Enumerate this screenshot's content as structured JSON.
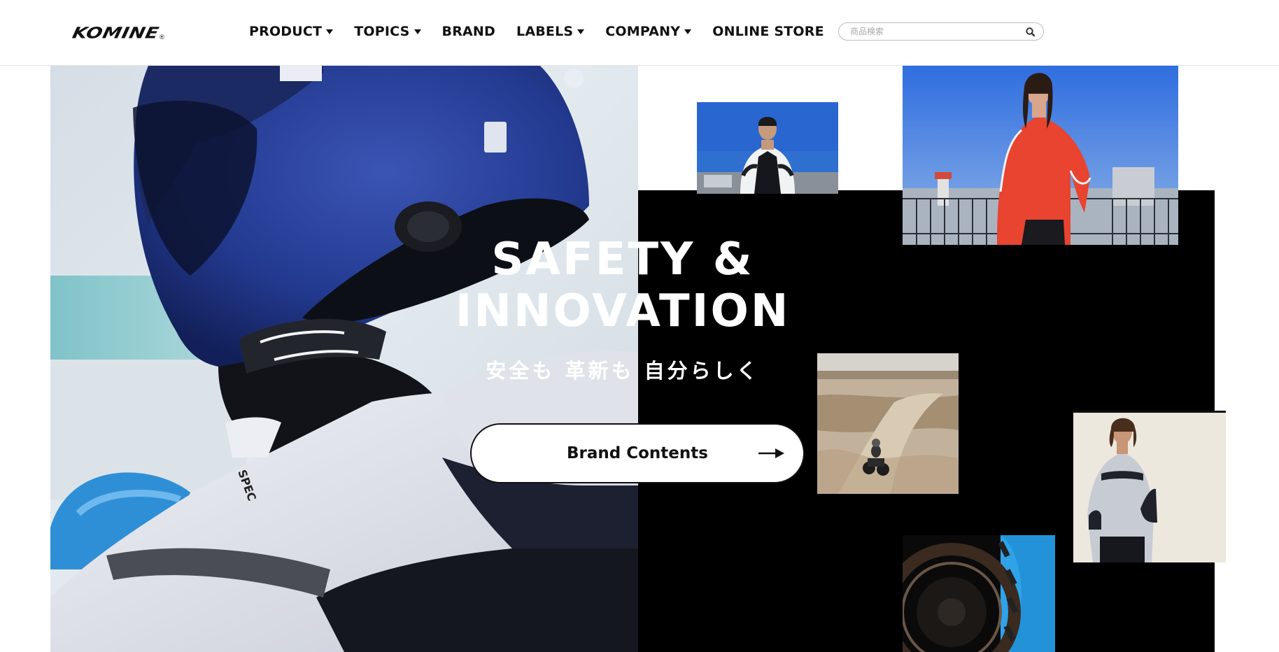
{
  "header": {
    "logo": "KOMINE",
    "logo_mark": "®",
    "nav": [
      {
        "label": "PRODUCT",
        "has_dropdown": true
      },
      {
        "label": "TOPICS",
        "has_dropdown": true
      },
      {
        "label": "BRAND",
        "has_dropdown": false
      },
      {
        "label": "LABELS",
        "has_dropdown": true
      },
      {
        "label": "COMPANY",
        "has_dropdown": true
      },
      {
        "label": "ONLINE STORE",
        "has_dropdown": false
      }
    ],
    "search": {
      "placeholder": "商品検索",
      "value": "",
      "icon": "search-icon"
    }
  },
  "hero": {
    "headline_line1": "SAFETY &",
    "headline_line2": "INNOVATION",
    "subline": "安全も 革新も 自分らしく",
    "cta_label": "Brand Contents",
    "cta_icon": "arrow-right-icon"
  },
  "colors": {
    "text": "#111111",
    "panel": "#000000",
    "background": "#ffffff",
    "helmet": "#23388f",
    "jacket_red": "#e8442f"
  }
}
